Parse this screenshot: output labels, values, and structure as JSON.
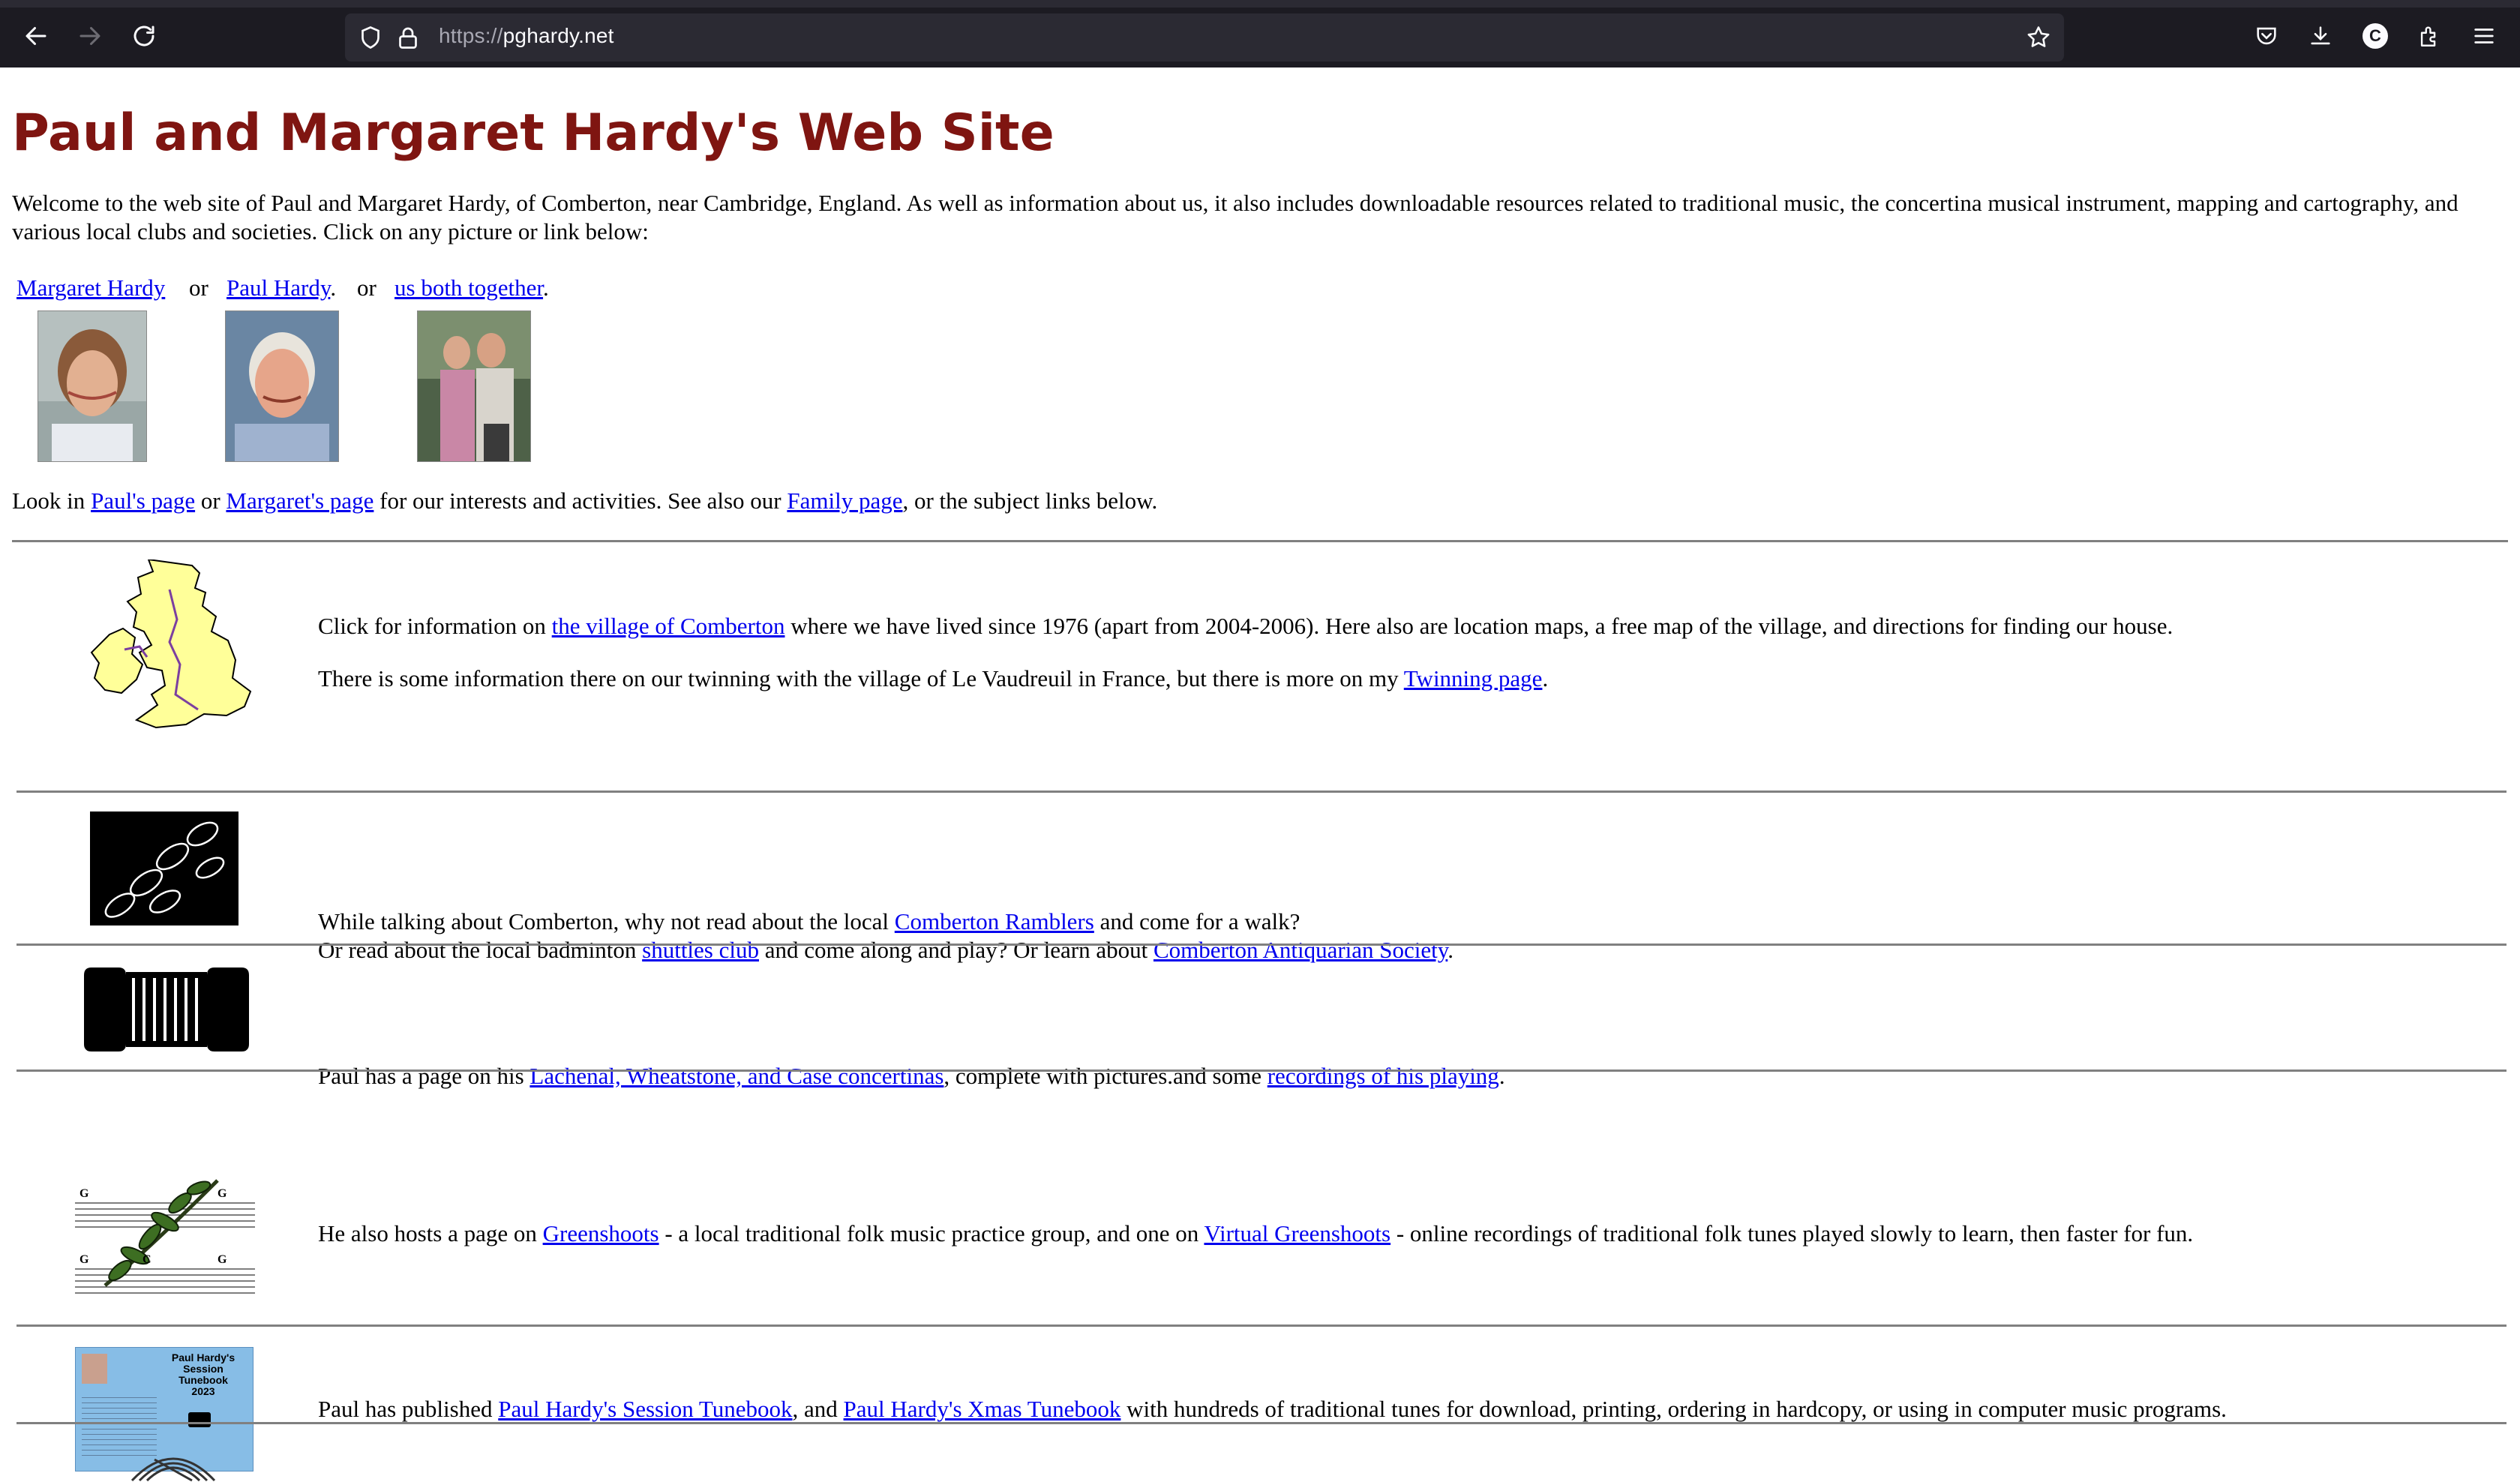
{
  "browser": {
    "url_scheme": "https://",
    "url_host": "pghardy.net",
    "avatar_letter": "C"
  },
  "page": {
    "title": "Paul and Margaret Hardy's Web Site",
    "intro": "Welcome to the web site of Paul and Margaret Hardy, of Comberton, near Cambridge, England. As well as information about us, it also includes downloadable resources related to traditional music, the concertina musical instrument, mapping and cartography, and various local clubs and societies. Click on any picture or link below:",
    "people": {
      "margaret": "Margaret Hardy",
      "or1": "or",
      "paul": "Paul Hardy",
      "dot1": ".",
      "or2": "or",
      "both": "us both together",
      "dot2": "."
    },
    "look": {
      "prefix": "Look in ",
      "pauls_page": "Paul's page",
      "or": " or ",
      "margarets_page": "Margaret's page",
      "middle": " for our interests and activities. See also our ",
      "family_page": "Family page",
      "suffix": ", or the subject links below."
    },
    "rows": {
      "comberton": {
        "l1_prefix": "Click for information on ",
        "l1_link": "the village of Comberton",
        "l1_suffix": " where we have lived since 1976 (apart from 2004-2006). Here also are location maps, a free map of the village, and directions for finding our house.",
        "l2_prefix": "There is some information there on our twinning with the village of Le Vaudreuil in France, but there is more on my ",
        "l2_link": "Twinning page",
        "l2_suffix": "."
      },
      "ramblers": {
        "l1_prefix": "While talking about Comberton, why not read about the local ",
        "l1_link": "Comberton Ramblers",
        "l1_suffix": " and come for a walk?",
        "l2_prefix": "Or read about the local badminton ",
        "l2_link1": "shuttles club",
        "l2_middle": " and come along and play? Or learn about ",
        "l2_link2": "Comberton Antiquarian Society",
        "l2_suffix": "."
      },
      "concertina": {
        "prefix": "Paul has a page on his ",
        "link1": "Lachenal, Wheatstone, and Case concertinas",
        "middle": ", complete with pictures.and some ",
        "link2": "recordings of his playing",
        "suffix": "."
      },
      "greenshoots": {
        "prefix": "He also hosts a page on ",
        "link1": "Greenshoots",
        "middle": " - a local traditional folk music practice group, and one on ",
        "link2": "Virtual Greenshoots",
        "suffix": " - online recordings of traditional folk tunes played slowly to learn, then faster for fun."
      },
      "tunebook": {
        "prefix": "Paul has published ",
        "link1": "Paul Hardy's Session Tunebook",
        "middle": ", and ",
        "link2": "Paul Hardy's Xmas Tunebook",
        "suffix": " with hundreds of traditional tunes for download, printing, ordering in hardcopy, or using in computer music programs.",
        "cover_title1": "Paul Hardy's",
        "cover_title2": "Session",
        "cover_title3": "Tunebook",
        "cover_year": "2023"
      }
    }
  },
  "colors": {
    "title": "#7f1511",
    "link": "#0000ee",
    "chrome_bg": "#1c1b22",
    "urlbar_bg": "#2b2a33",
    "map_fill": "#ffff99",
    "tunebook_bg": "#87bde6"
  },
  "icons": [
    "back-arrow-icon",
    "forward-arrow-icon",
    "reload-icon",
    "shield-icon",
    "lock-icon",
    "star-icon",
    "pocket-icon",
    "download-icon",
    "extensions-icon",
    "menu-icon"
  ]
}
